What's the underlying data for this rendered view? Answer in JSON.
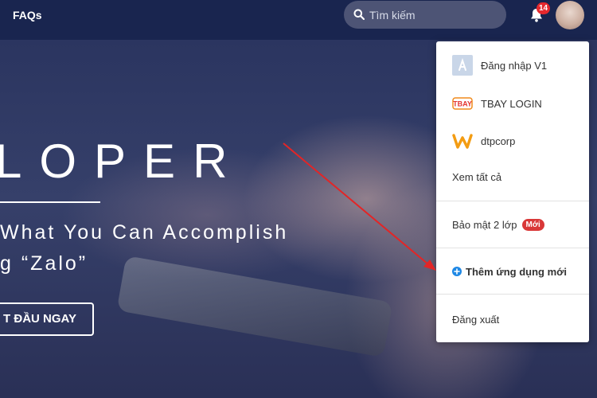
{
  "topbar": {
    "faqs_label": "FAQs",
    "search_placeholder": "Tìm kiếm",
    "notification_count": "14"
  },
  "hero": {
    "heading": "LOPER",
    "subtitle_line1": "What You Can Accomplish",
    "subtitle_line2": "g “Zalo”",
    "cta_label": "T ĐẦU NGAY"
  },
  "menu": {
    "apps": [
      {
        "label": "Đăng nhập V1",
        "icon": "app-store-icon"
      },
      {
        "label": "TBAY LOGIN",
        "icon": "tbay-logo-icon"
      },
      {
        "label": "dtpcorp",
        "icon": "w-logo-icon"
      }
    ],
    "see_all_label": "Xem tất cả",
    "two_factor_label": "Bảo mật 2 lớp",
    "new_badge_label": "Mới",
    "add_app_label": "Thêm ứng dụng mới",
    "logout_label": "Đăng xuất"
  },
  "colors": {
    "topbar": "#19254f",
    "badge": "#e5282d",
    "accent_blue": "#1e88e5",
    "annotation_arrow": "#e32526"
  }
}
